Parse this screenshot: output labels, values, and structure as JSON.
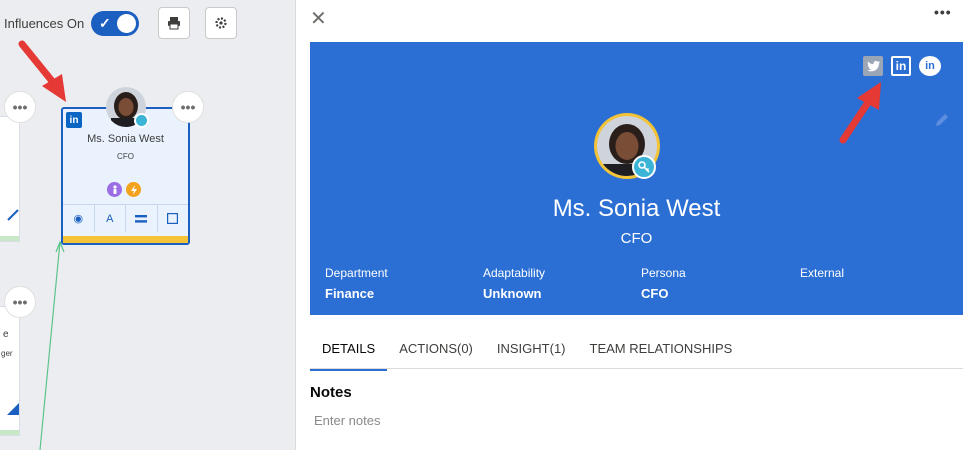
{
  "toolbar": {
    "influences_label": "Influences On",
    "influences_on": true,
    "print_icon": "printer-icon",
    "settings_icon": "gear-icon"
  },
  "org_node": {
    "name": "Ms. Sonia West",
    "title": "CFO",
    "social_icon": "linkedin-icon",
    "avatar_badge_icon": "key-icon",
    "badges": [
      {
        "icon": "person-icon",
        "color": "#9b6ee6"
      },
      {
        "icon": "lightning-icon",
        "color": "#f4a21c"
      }
    ],
    "actions": [
      {
        "icon": "target-icon",
        "text": "◉"
      },
      {
        "icon": "font-icon",
        "text": "A"
      },
      {
        "icon": "equals-icon",
        "text": "="
      },
      {
        "icon": "square-icon",
        "text": "□"
      }
    ],
    "accent_bar_color": "#f4c338"
  },
  "side_fragments": {
    "more_symbol": "•••",
    "fragment_line_1": "e",
    "fragment_line_2": "ger"
  },
  "panel": {
    "close_symbol": "✕",
    "more_symbol": "•••",
    "hero": {
      "background_color": "#2b6fd4",
      "name": "Ms. Sonia West",
      "role": "CFO",
      "social_icons": [
        "twitter-icon",
        "linkedin-icon",
        "chatter-icon"
      ],
      "fields": [
        {
          "label": "Department",
          "value": "Finance"
        },
        {
          "label": "Adaptability",
          "value": "Unknown"
        },
        {
          "label": "Persona",
          "value": "CFO"
        },
        {
          "label": "External",
          "value": ""
        }
      ]
    },
    "tabs": [
      {
        "label": "DETAILS",
        "active": true
      },
      {
        "label": "ACTIONS(0)",
        "active": false
      },
      {
        "label": "INSIGHT(1)",
        "active": false
      },
      {
        "label": "TEAM RELATIONSHIPS",
        "active": false
      }
    ],
    "notes": {
      "heading": "Notes",
      "placeholder": "Enter notes"
    }
  }
}
